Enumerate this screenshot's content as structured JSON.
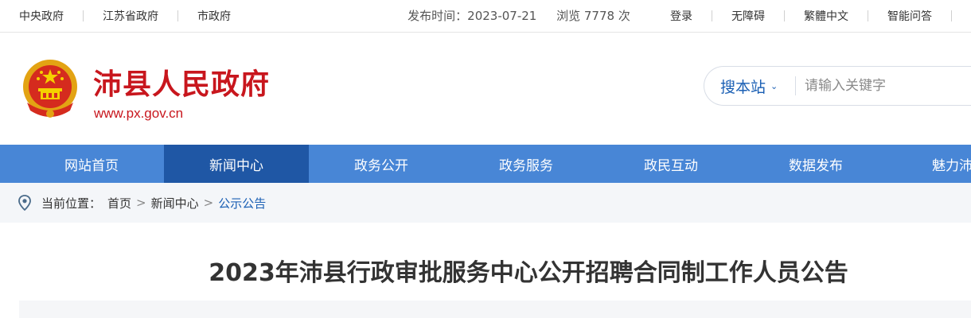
{
  "topbar": {
    "left_links": [
      "中央政府",
      "江苏省政府",
      "市政府"
    ],
    "right_links": [
      "登录",
      "无障碍",
      "繁體中文",
      "智能问答"
    ]
  },
  "header": {
    "site_title": "沛县人民政府",
    "site_url": "www.px.gov.cn",
    "emblem_icon": "national-emblem-icon"
  },
  "search": {
    "scope_label": "搜本站",
    "placeholder": "请输入关键字"
  },
  "nav": {
    "items": [
      "网站首页",
      "新闻中心",
      "政务公开",
      "政务服务",
      "政民互动",
      "数据发布",
      "魅力沛"
    ],
    "active_index": 1
  },
  "breadcrumb": {
    "prefix": "当前位置：",
    "items": [
      "首页",
      "新闻中心",
      "公示公告"
    ]
  },
  "article": {
    "title": "2023年沛县行政审批服务中心公开招聘合同制工作人员公告",
    "publish_label": "发布时间：2023-07-21",
    "views_label": "浏览 7778 次"
  },
  "colors": {
    "brand_red": "#c8161d",
    "nav_blue": "#4886d6",
    "nav_active": "#1f57a5",
    "link_blue": "#1a5fb4"
  }
}
